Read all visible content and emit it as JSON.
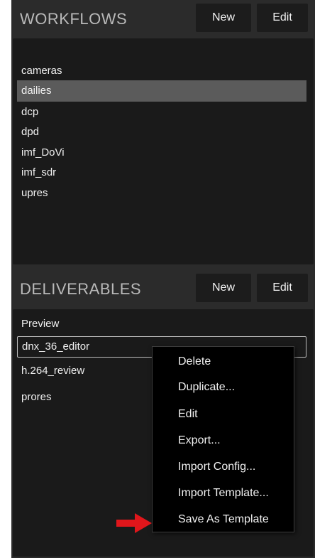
{
  "workflows": {
    "title": "WORKFLOWS",
    "new_label": "New",
    "edit_label": "Edit",
    "items": [
      "cameras",
      "dailies",
      "dcp",
      "dpd",
      "imf_DoVi",
      "imf_sdr",
      "upres"
    ],
    "selected": "dailies"
  },
  "deliverables": {
    "title": "DELIVERABLES",
    "new_label": "New",
    "edit_label": "Edit",
    "items": [
      "Preview",
      "dnx_36_editor",
      "h.264_review",
      "prores"
    ],
    "selected": "dnx_36_editor"
  },
  "context_menu": {
    "items": [
      "Delete",
      "Duplicate...",
      "Edit",
      "Export...",
      "Import Config...",
      "Import Template...",
      "Save As Template"
    ],
    "highlighted": "Save As Template"
  },
  "colors": {
    "panel_bg": "#2b2b2b",
    "list_bg": "#1a1a1a",
    "selection": "#5b5b5b",
    "arrow": "#e0161b"
  },
  "icons": {
    "pointer_arrow": "red-arrow-icon"
  }
}
